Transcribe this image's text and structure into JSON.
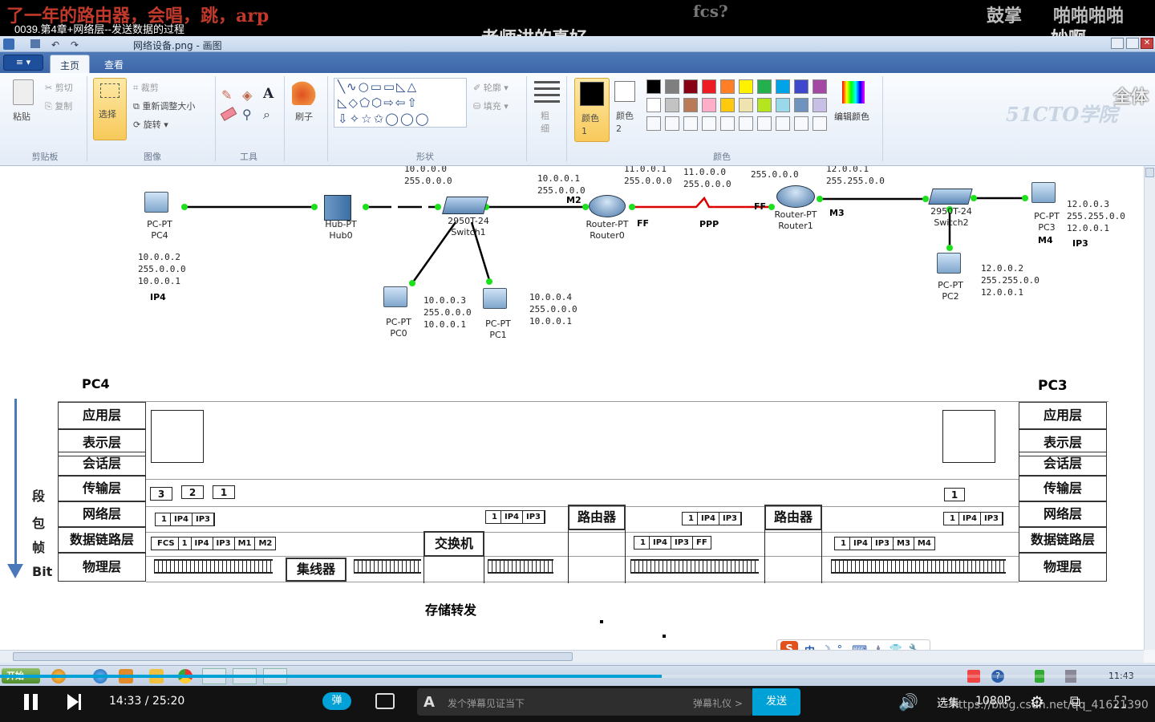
{
  "overlay": {
    "video_title": "0039.第4章+网络层--发送数据的过程",
    "danmaku": [
      "了一年的路由器，会唱，跳，arp",
      "fcs?",
      "老师讲的真好",
      "鼓掌",
      "啪啪啪啪",
      "妙啊",
      "全体"
    ],
    "watermark": "51CTO学院"
  },
  "paint": {
    "title": "网络设备.png - 画图",
    "tabs": [
      {
        "label": "主页"
      },
      {
        "label": "查看"
      }
    ],
    "clipboard": {
      "paste": "粘贴",
      "cut": "剪切",
      "copy": "复制",
      "group": "剪贴板"
    },
    "image": {
      "select": "选择",
      "crop": "裁剪",
      "resize": "重新调整大小",
      "rotate": "旋转",
      "group": "图像"
    },
    "tools": {
      "group": "工具",
      "text_tool": "A"
    },
    "brush": {
      "label": "刷子"
    },
    "shapes": {
      "outline": "轮廓",
      "fill": "填充",
      "group": "形状"
    },
    "size": {
      "label": "粗细"
    },
    "colors": {
      "color1_label": "颜色 1",
      "color2_label": "颜色 2",
      "edit": "编辑颜色",
      "group": "颜色",
      "palette": [
        "#000000",
        "#7f7f7f",
        "#880015",
        "#ed1c24",
        "#ff7f27",
        "#fff200",
        "#22b14c",
        "#00a2e8",
        "#3f48cc",
        "#a349a4",
        "#ffffff",
        "#c3c3c3",
        "#b97a57",
        "#ffaec9",
        "#ffc90e",
        "#efe4b0",
        "#b5e61d",
        "#99d9ea",
        "#7092be",
        "#c8bfe7"
      ]
    }
  },
  "diagram": {
    "devices": [
      {
        "name": "PC-PT\nPC4"
      },
      {
        "name": "Hub-PT\nHub0"
      },
      {
        "name": "2950T-24\nSwitch1"
      },
      {
        "name": "Router-PT\nRouter0"
      },
      {
        "name": "Router-PT\nRouter1"
      },
      {
        "name": "2950T-24\nSwitch2"
      },
      {
        "name": "PC-PT\nPC3"
      },
      {
        "name": "PC-PT\nPC2"
      },
      {
        "name": "PC-PT\nPC0"
      },
      {
        "name": "PC-PT\nPC1"
      }
    ],
    "addr": {
      "pc4": "10.0.0.2\n255.0.0.0\n10.0.0.1",
      "net10": "10.0.0.0\n255.0.0.0",
      "r0": "10.0.0.1\n255.0.0.0",
      "r0b": "11.0.0.1\n255.0.0.0",
      "net11": "11.0.0.0\n255.0.0.0",
      "mask255": "255.0.0.0",
      "r1": "12.0.0.1\n255.255.0.0",
      "pc3": "12.0.0.3\n255.255.0.0\n12.0.0.1",
      "pc2": "12.0.0.2\n255.255.0.0\n12.0.0.1",
      "pc0": "10.0.0.3\n255.0.0.0\n10.0.0.1",
      "pc1": "10.0.0.4\n255.0.0.0\n10.0.0.1"
    },
    "labels": {
      "ip4": "IP4",
      "m2": "M2",
      "ff1": "FF",
      "ppp": "PPP",
      "ff2": "FF",
      "m3": "M3",
      "m4": "M4",
      "ip3": "IP3"
    }
  },
  "osi": {
    "left_title": "PC4",
    "right_title": "PC3",
    "layers": [
      "应用层",
      "表示层",
      "会话层",
      "传输层",
      "网络层",
      "数据链路层",
      "物理层"
    ],
    "side": [
      "段",
      "包",
      "帧",
      "Bit"
    ],
    "transport_nums": [
      "3",
      "2",
      "1"
    ],
    "pkt_net": [
      "1",
      "IP4",
      "IP3"
    ],
    "pkt_dl_left": [
      "FCS",
      "1",
      "IP4",
      "IP3",
      "M1",
      "M2"
    ],
    "pkt_dl_mid": [
      "1",
      "IP4",
      "IP3",
      "FF"
    ],
    "pkt_dl_right": [
      "1",
      "IP4",
      "IP3",
      "M3",
      "M4"
    ],
    "hub": "集线器",
    "switch": "交换机",
    "router": "路由器",
    "store_forward": "存储转发"
  },
  "taskbar": {
    "start": "开始",
    "clock": "11:43"
  },
  "player": {
    "time": "14:33 / 25:20",
    "danmaku_toggle": "弹",
    "input_placeholder": "发个弹幕见证当下",
    "etiquette": "弹幕礼仪 >",
    "send": "发送",
    "episodes": "选集",
    "quality": "1080P",
    "progress": 0.573,
    "url": "https://blog.csdn.net/qq_41621390"
  }
}
